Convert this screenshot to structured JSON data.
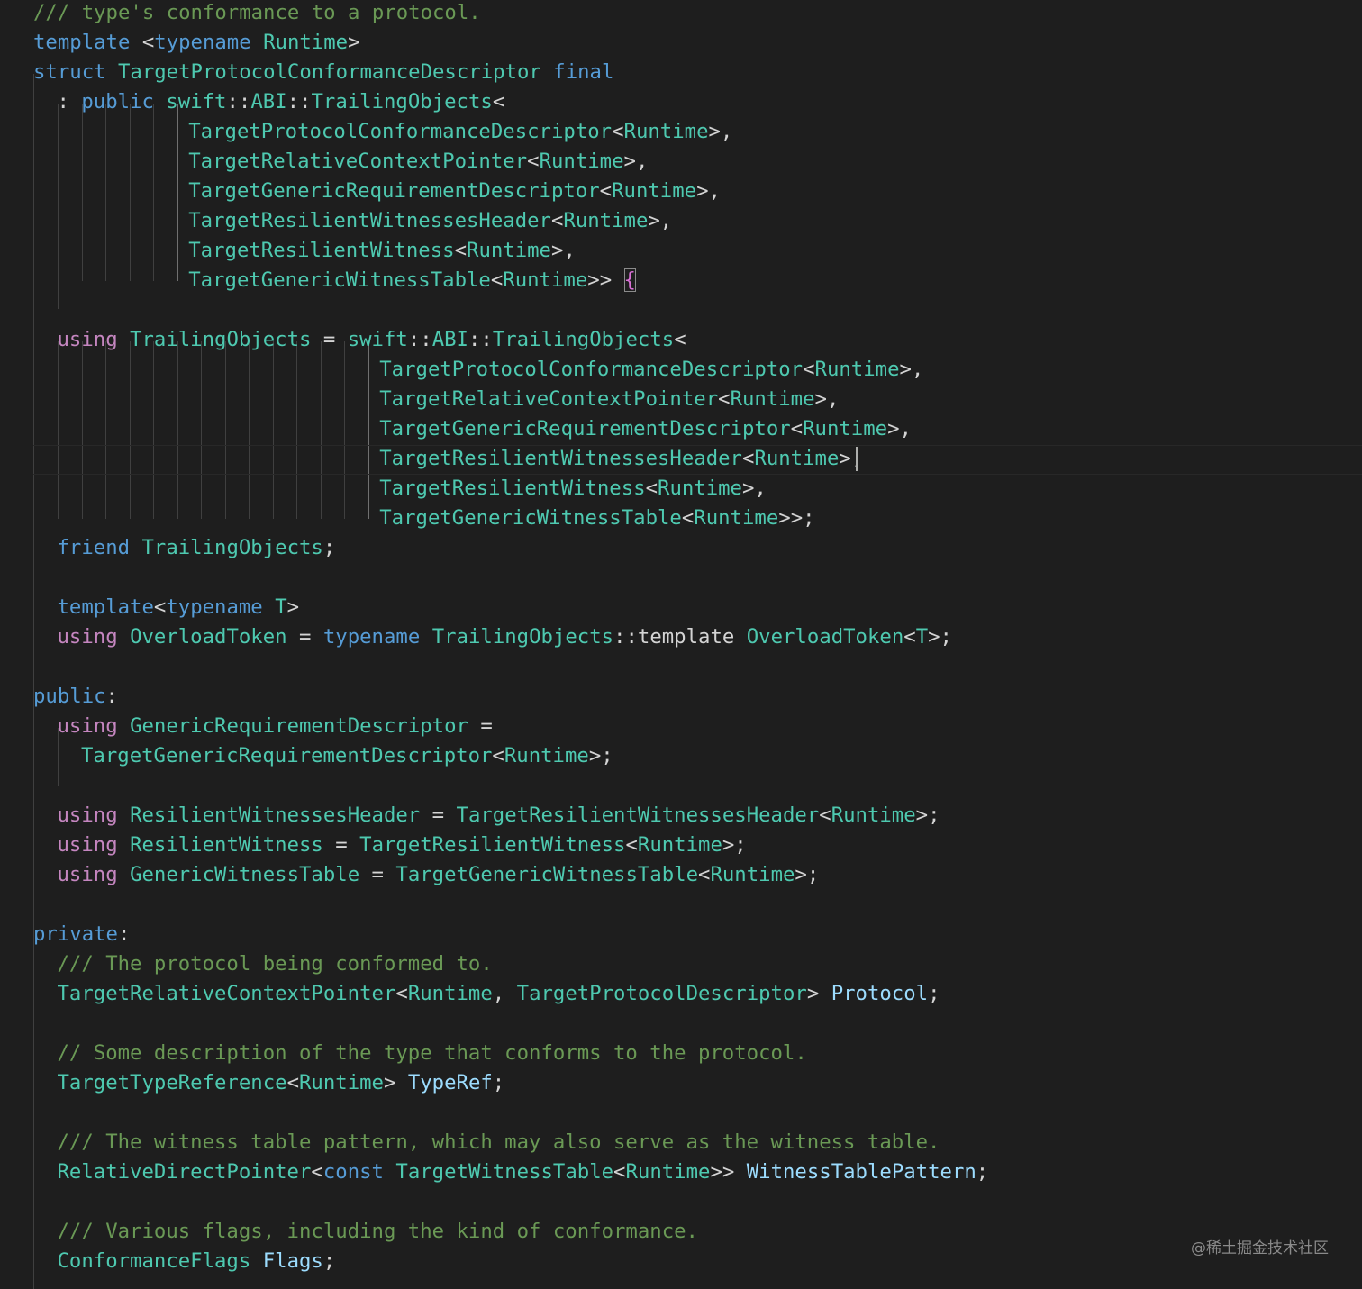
{
  "editor": {
    "theme": "dark",
    "colors": {
      "background": "#1e1e1e",
      "keyword_blue": "#569cd6",
      "keyword_purple": "#c586c0",
      "type": "#4ec9b0",
      "variable": "#9cdcfe",
      "comment": "#6a9955",
      "plain": "#d4d4d4",
      "bracket": "#da70d6"
    },
    "cursor": {
      "line": 15
    },
    "matched_bracket": "{",
    "lines": [
      {
        "indent": 0,
        "tokens": [
          [
            "comment",
            "/// type's conformance to a protocol."
          ]
        ]
      },
      {
        "indent": 0,
        "tokens": [
          [
            "kw-blue",
            "template"
          ],
          [
            "plain",
            " <"
          ],
          [
            "kw-blue",
            "typename"
          ],
          [
            "plain",
            " "
          ],
          [
            "type",
            "Runtime"
          ],
          [
            "plain",
            ">"
          ]
        ]
      },
      {
        "indent": 0,
        "tokens": [
          [
            "kw-blue",
            "struct"
          ],
          [
            "plain",
            " "
          ],
          [
            "type",
            "TargetProtocolConformanceDescriptor"
          ],
          [
            "plain",
            " "
          ],
          [
            "kw-blue",
            "final"
          ]
        ]
      },
      {
        "indent": 1,
        "tokens": [
          [
            "plain",
            ": "
          ],
          [
            "kw-blue",
            "public"
          ],
          [
            "plain",
            " "
          ],
          [
            "type",
            "swift"
          ],
          [
            "plain",
            "::"
          ],
          [
            "type",
            "ABI"
          ],
          [
            "plain",
            "::"
          ],
          [
            "type",
            "TrailingObjects"
          ],
          [
            "plain",
            "<"
          ]
        ]
      },
      {
        "indent": 6.5,
        "tokens": [
          [
            "type",
            "TargetProtocolConformanceDescriptor"
          ],
          [
            "plain",
            "<"
          ],
          [
            "type",
            "Runtime"
          ],
          [
            "plain",
            ">,"
          ]
        ]
      },
      {
        "indent": 6.5,
        "tokens": [
          [
            "type",
            "TargetRelativeContextPointer"
          ],
          [
            "plain",
            "<"
          ],
          [
            "type",
            "Runtime"
          ],
          [
            "plain",
            ">,"
          ]
        ]
      },
      {
        "indent": 6.5,
        "tokens": [
          [
            "type",
            "TargetGenericRequirementDescriptor"
          ],
          [
            "plain",
            "<"
          ],
          [
            "type",
            "Runtime"
          ],
          [
            "plain",
            ">,"
          ]
        ]
      },
      {
        "indent": 6.5,
        "tokens": [
          [
            "type",
            "TargetResilientWitnessesHeader"
          ],
          [
            "plain",
            "<"
          ],
          [
            "type",
            "Runtime"
          ],
          [
            "plain",
            ">,"
          ]
        ]
      },
      {
        "indent": 6.5,
        "tokens": [
          [
            "type",
            "TargetResilientWitness"
          ],
          [
            "plain",
            "<"
          ],
          [
            "type",
            "Runtime"
          ],
          [
            "plain",
            ">,"
          ]
        ]
      },
      {
        "indent": 6.5,
        "tokens": [
          [
            "type",
            "TargetGenericWitnessTable"
          ],
          [
            "plain",
            "<"
          ],
          [
            "type",
            "Runtime"
          ],
          [
            "plain",
            ">> "
          ],
          [
            "brace",
            "{"
          ]
        ]
      },
      {
        "indent": 0,
        "tokens": []
      },
      {
        "indent": 1,
        "tokens": [
          [
            "kw-purple",
            "using"
          ],
          [
            "plain",
            " "
          ],
          [
            "type",
            "TrailingObjects"
          ],
          [
            "plain",
            " = "
          ],
          [
            "type",
            "swift"
          ],
          [
            "plain",
            "::"
          ],
          [
            "type",
            "ABI"
          ],
          [
            "plain",
            "::"
          ],
          [
            "type",
            "TrailingObjects"
          ],
          [
            "plain",
            "<"
          ]
        ]
      },
      {
        "indent": 14.5,
        "tokens": [
          [
            "type",
            "TargetProtocolConformanceDescriptor"
          ],
          [
            "plain",
            "<"
          ],
          [
            "type",
            "Runtime"
          ],
          [
            "plain",
            ">,"
          ]
        ]
      },
      {
        "indent": 14.5,
        "tokens": [
          [
            "type",
            "TargetRelativeContextPointer"
          ],
          [
            "plain",
            "<"
          ],
          [
            "type",
            "Runtime"
          ],
          [
            "plain",
            ">,"
          ]
        ]
      },
      {
        "indent": 14.5,
        "tokens": [
          [
            "type",
            "TargetGenericRequirementDescriptor"
          ],
          [
            "plain",
            "<"
          ],
          [
            "type",
            "Runtime"
          ],
          [
            "plain",
            ">,"
          ]
        ]
      },
      {
        "indent": 14.5,
        "tokens": [
          [
            "type",
            "TargetResilientWitnessesHeader"
          ],
          [
            "plain",
            "<"
          ],
          [
            "type",
            "Runtime"
          ],
          [
            "plain",
            ">,"
          ]
        ]
      },
      {
        "indent": 14.5,
        "tokens": [
          [
            "type",
            "TargetResilientWitness"
          ],
          [
            "plain",
            "<"
          ],
          [
            "type",
            "Runtime"
          ],
          [
            "plain",
            ">,"
          ]
        ]
      },
      {
        "indent": 14.5,
        "tokens": [
          [
            "type",
            "TargetGenericWitnessTable"
          ],
          [
            "plain",
            "<"
          ],
          [
            "type",
            "Runtime"
          ],
          [
            "plain",
            ">>;"
          ]
        ]
      },
      {
        "indent": 1,
        "tokens": [
          [
            "kw-blue",
            "friend"
          ],
          [
            "plain",
            " "
          ],
          [
            "type",
            "TrailingObjects"
          ],
          [
            "plain",
            ";"
          ]
        ]
      },
      {
        "indent": 0,
        "tokens": []
      },
      {
        "indent": 1,
        "tokens": [
          [
            "kw-blue",
            "template"
          ],
          [
            "plain",
            "<"
          ],
          [
            "kw-blue",
            "typename"
          ],
          [
            "plain",
            " "
          ],
          [
            "type",
            "T"
          ],
          [
            "plain",
            ">"
          ]
        ]
      },
      {
        "indent": 1,
        "tokens": [
          [
            "kw-purple",
            "using"
          ],
          [
            "plain",
            " "
          ],
          [
            "type",
            "OverloadToken"
          ],
          [
            "plain",
            " = "
          ],
          [
            "kw-blue",
            "typename"
          ],
          [
            "plain",
            " "
          ],
          [
            "type",
            "TrailingObjects"
          ],
          [
            "plain",
            "::template "
          ],
          [
            "type",
            "OverloadToken"
          ],
          [
            "plain",
            "<"
          ],
          [
            "type",
            "T"
          ],
          [
            "plain",
            ">;"
          ]
        ]
      },
      {
        "indent": 0,
        "tokens": []
      },
      {
        "indent": 0,
        "tokens": [
          [
            "kw-blue",
            "public"
          ],
          [
            "plain",
            ":"
          ]
        ]
      },
      {
        "indent": 1,
        "tokens": [
          [
            "kw-purple",
            "using"
          ],
          [
            "plain",
            " "
          ],
          [
            "type",
            "GenericRequirementDescriptor"
          ],
          [
            "plain",
            " ="
          ]
        ]
      },
      {
        "indent": 2,
        "tokens": [
          [
            "type",
            "TargetGenericRequirementDescriptor"
          ],
          [
            "plain",
            "<"
          ],
          [
            "type",
            "Runtime"
          ],
          [
            "plain",
            ">;"
          ]
        ]
      },
      {
        "indent": 0,
        "tokens": []
      },
      {
        "indent": 1,
        "tokens": [
          [
            "kw-purple",
            "using"
          ],
          [
            "plain",
            " "
          ],
          [
            "type",
            "ResilientWitnessesHeader"
          ],
          [
            "plain",
            " = "
          ],
          [
            "type",
            "TargetResilientWitnessesHeader"
          ],
          [
            "plain",
            "<"
          ],
          [
            "type",
            "Runtime"
          ],
          [
            "plain",
            ">;"
          ]
        ]
      },
      {
        "indent": 1,
        "tokens": [
          [
            "kw-purple",
            "using"
          ],
          [
            "plain",
            " "
          ],
          [
            "type",
            "ResilientWitness"
          ],
          [
            "plain",
            " = "
          ],
          [
            "type",
            "TargetResilientWitness"
          ],
          [
            "plain",
            "<"
          ],
          [
            "type",
            "Runtime"
          ],
          [
            "plain",
            ">;"
          ]
        ]
      },
      {
        "indent": 1,
        "tokens": [
          [
            "kw-purple",
            "using"
          ],
          [
            "plain",
            " "
          ],
          [
            "type",
            "GenericWitnessTable"
          ],
          [
            "plain",
            " = "
          ],
          [
            "type",
            "TargetGenericWitnessTable"
          ],
          [
            "plain",
            "<"
          ],
          [
            "type",
            "Runtime"
          ],
          [
            "plain",
            ">;"
          ]
        ]
      },
      {
        "indent": 0,
        "tokens": []
      },
      {
        "indent": 0,
        "tokens": [
          [
            "kw-blue",
            "private"
          ],
          [
            "plain",
            ":"
          ]
        ]
      },
      {
        "indent": 1,
        "tokens": [
          [
            "comment",
            "/// The protocol being conformed to."
          ]
        ]
      },
      {
        "indent": 1,
        "tokens": [
          [
            "type",
            "TargetRelativeContextPointer"
          ],
          [
            "plain",
            "<"
          ],
          [
            "type",
            "Runtime"
          ],
          [
            "plain",
            ", "
          ],
          [
            "type",
            "TargetProtocolDescriptor"
          ],
          [
            "plain",
            "> "
          ],
          [
            "var",
            "Protocol"
          ],
          [
            "plain",
            ";"
          ]
        ]
      },
      {
        "indent": 0,
        "tokens": []
      },
      {
        "indent": 1,
        "tokens": [
          [
            "comment",
            "// Some description of the type that conforms to the protocol."
          ]
        ]
      },
      {
        "indent": 1,
        "tokens": [
          [
            "type",
            "TargetTypeReference"
          ],
          [
            "plain",
            "<"
          ],
          [
            "type",
            "Runtime"
          ],
          [
            "plain",
            "> "
          ],
          [
            "var",
            "TypeRef"
          ],
          [
            "plain",
            ";"
          ]
        ]
      },
      {
        "indent": 0,
        "tokens": []
      },
      {
        "indent": 1,
        "tokens": [
          [
            "comment",
            "/// The witness table pattern, which may also serve as the witness table."
          ]
        ]
      },
      {
        "indent": 1,
        "tokens": [
          [
            "type",
            "RelativeDirectPointer"
          ],
          [
            "plain",
            "<"
          ],
          [
            "kw-blue",
            "const"
          ],
          [
            "plain",
            " "
          ],
          [
            "type",
            "TargetWitnessTable"
          ],
          [
            "plain",
            "<"
          ],
          [
            "type",
            "Runtime"
          ],
          [
            "plain",
            ">> "
          ],
          [
            "var",
            "WitnessTablePattern"
          ],
          [
            "plain",
            ";"
          ]
        ]
      },
      {
        "indent": 0,
        "tokens": []
      },
      {
        "indent": 1,
        "tokens": [
          [
            "comment",
            "/// Various flags, including the kind of conformance."
          ]
        ]
      },
      {
        "indent": 1,
        "tokens": [
          [
            "type",
            "ConformanceFlags"
          ],
          [
            "plain",
            " "
          ],
          [
            "var",
            "Flags"
          ],
          [
            "plain",
            ";"
          ]
        ]
      }
    ]
  },
  "watermark": {
    "text": "@稀土掘金技术社区"
  }
}
